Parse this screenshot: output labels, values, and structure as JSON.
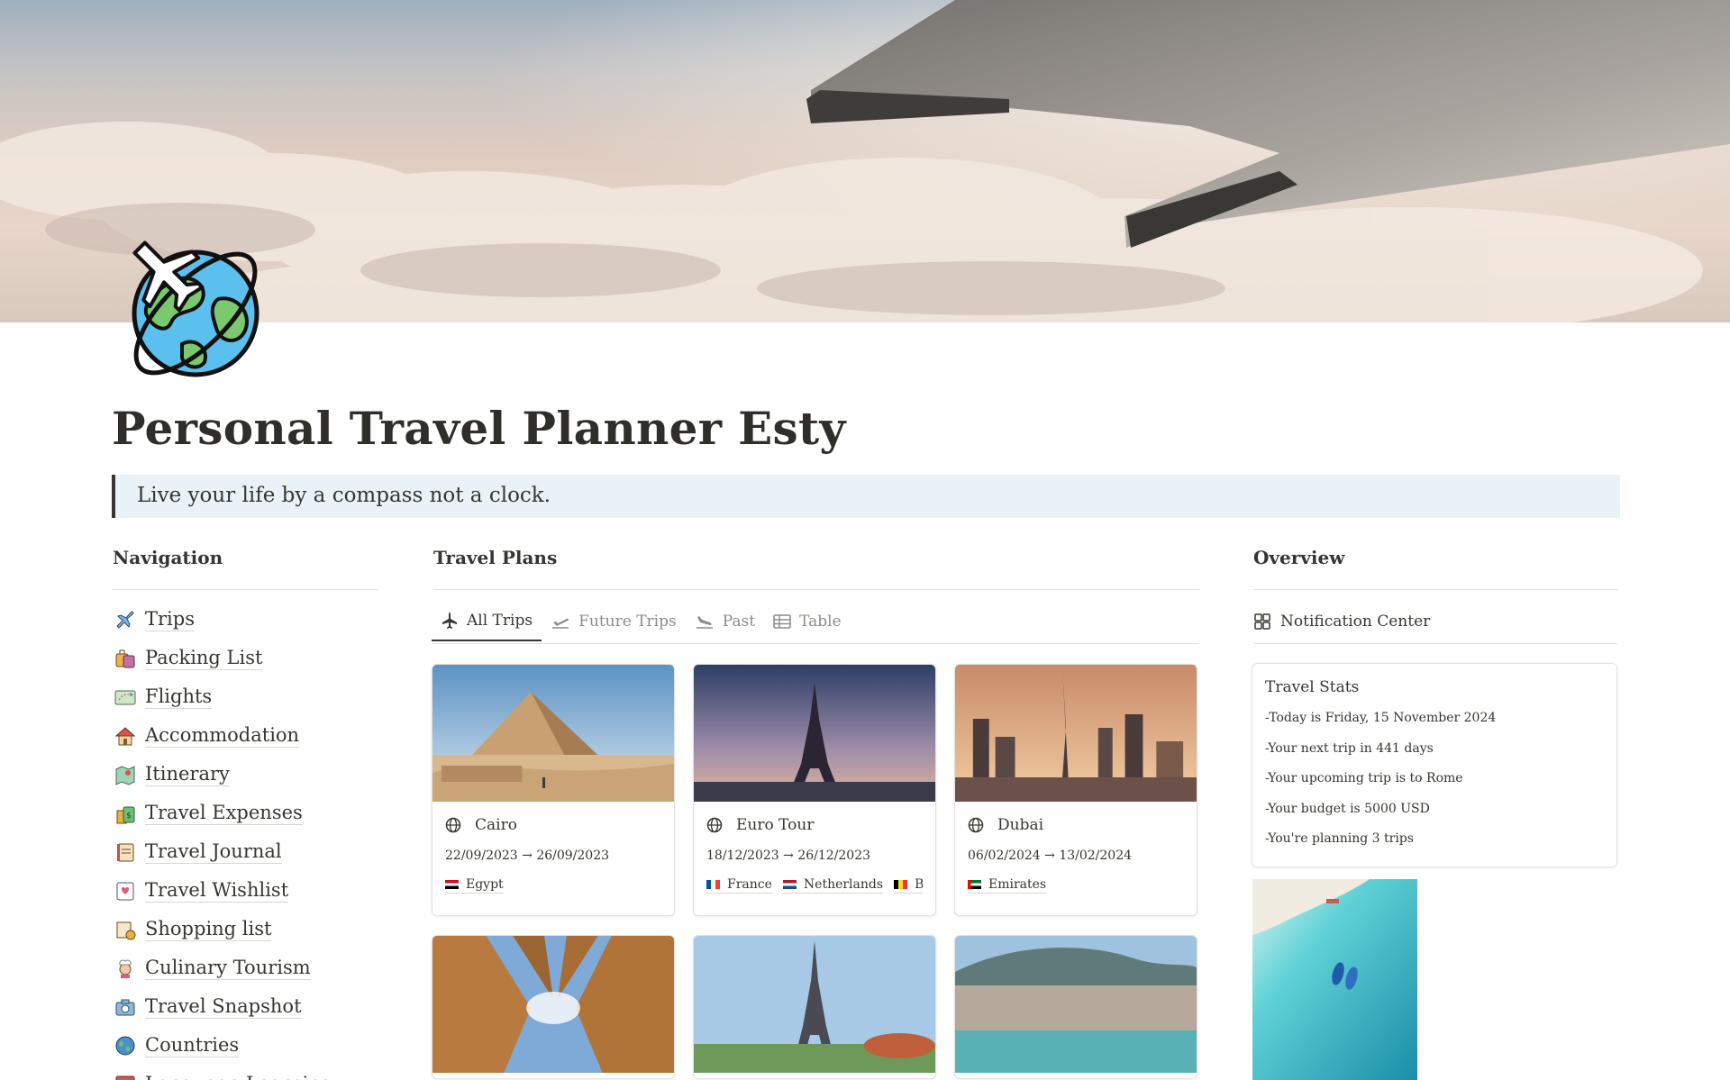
{
  "page": {
    "title": "Personal Travel Planner Esty",
    "quote": "Live your life by a compass not a clock."
  },
  "navigation": {
    "heading": "Navigation",
    "items": [
      {
        "label": "Trips",
        "icon": "airplane-icon"
      },
      {
        "label": "Packing List",
        "icon": "luggage-icon"
      },
      {
        "label": "Flights",
        "icon": "flight-map-icon"
      },
      {
        "label": "Accommodation",
        "icon": "house-icon"
      },
      {
        "label": "Itinerary",
        "icon": "map-icon"
      },
      {
        "label": "Travel Expenses",
        "icon": "money-icon"
      },
      {
        "label": "Travel Journal",
        "icon": "journal-icon"
      },
      {
        "label": "Travel Wishlist",
        "icon": "wishlist-icon"
      },
      {
        "label": "Shopping list",
        "icon": "shopping-bag-icon"
      },
      {
        "label": "Culinary Tourism",
        "icon": "chef-icon"
      },
      {
        "label": "Travel Snapshot",
        "icon": "camera-icon"
      },
      {
        "label": "Countries",
        "icon": "globe-icon"
      },
      {
        "label": "Language Learning",
        "icon": "language-icon"
      }
    ]
  },
  "travel_plans": {
    "heading": "Travel Plans",
    "tabs": [
      {
        "label": "All Trips",
        "icon": "airplane-icon",
        "active": true
      },
      {
        "label": "Future Trips",
        "icon": "plane-takeoff-icon",
        "active": false
      },
      {
        "label": "Past",
        "icon": "plane-landing-icon",
        "active": false
      },
      {
        "label": "Table",
        "icon": "table-icon",
        "active": false
      }
    ],
    "cards": [
      {
        "name": "Cairo",
        "dates": "22/09/2023 → 26/09/2023",
        "countries": [
          "Egypt"
        ],
        "image": "pyramid-photo"
      },
      {
        "name": "Euro Tour",
        "dates": "18/12/2023 → 26/12/2023",
        "countries": [
          "France",
          "Netherlands",
          "Belgium"
        ],
        "image": "eiffel-tower-dusk-photo"
      },
      {
        "name": "Dubai",
        "dates": "06/02/2024 → 13/02/2024",
        "countries": [
          "Emirates"
        ],
        "image": "dubai-skyline-photo"
      }
    ],
    "more_cards": [
      {
        "image": "temple-columns-photo"
      },
      {
        "image": "eiffel-tower-day-photo"
      },
      {
        "image": "coastal-city-photo"
      }
    ]
  },
  "overview": {
    "heading": "Overview",
    "notification_center": "Notification Center",
    "stats_title": "Travel Stats",
    "stats_lines": [
      "-Today is Friday, 15 November 2024",
      "-Your next trip in 441 days",
      "-Your upcoming trip is to Rome",
      "-Your budget is 5000 USD",
      "-You're planning 3 trips"
    ]
  },
  "colors": {
    "text": "#37352f",
    "muted": "#8e8c87",
    "quote_bg": "#e9f3f7",
    "border": "#e3e2e0"
  }
}
